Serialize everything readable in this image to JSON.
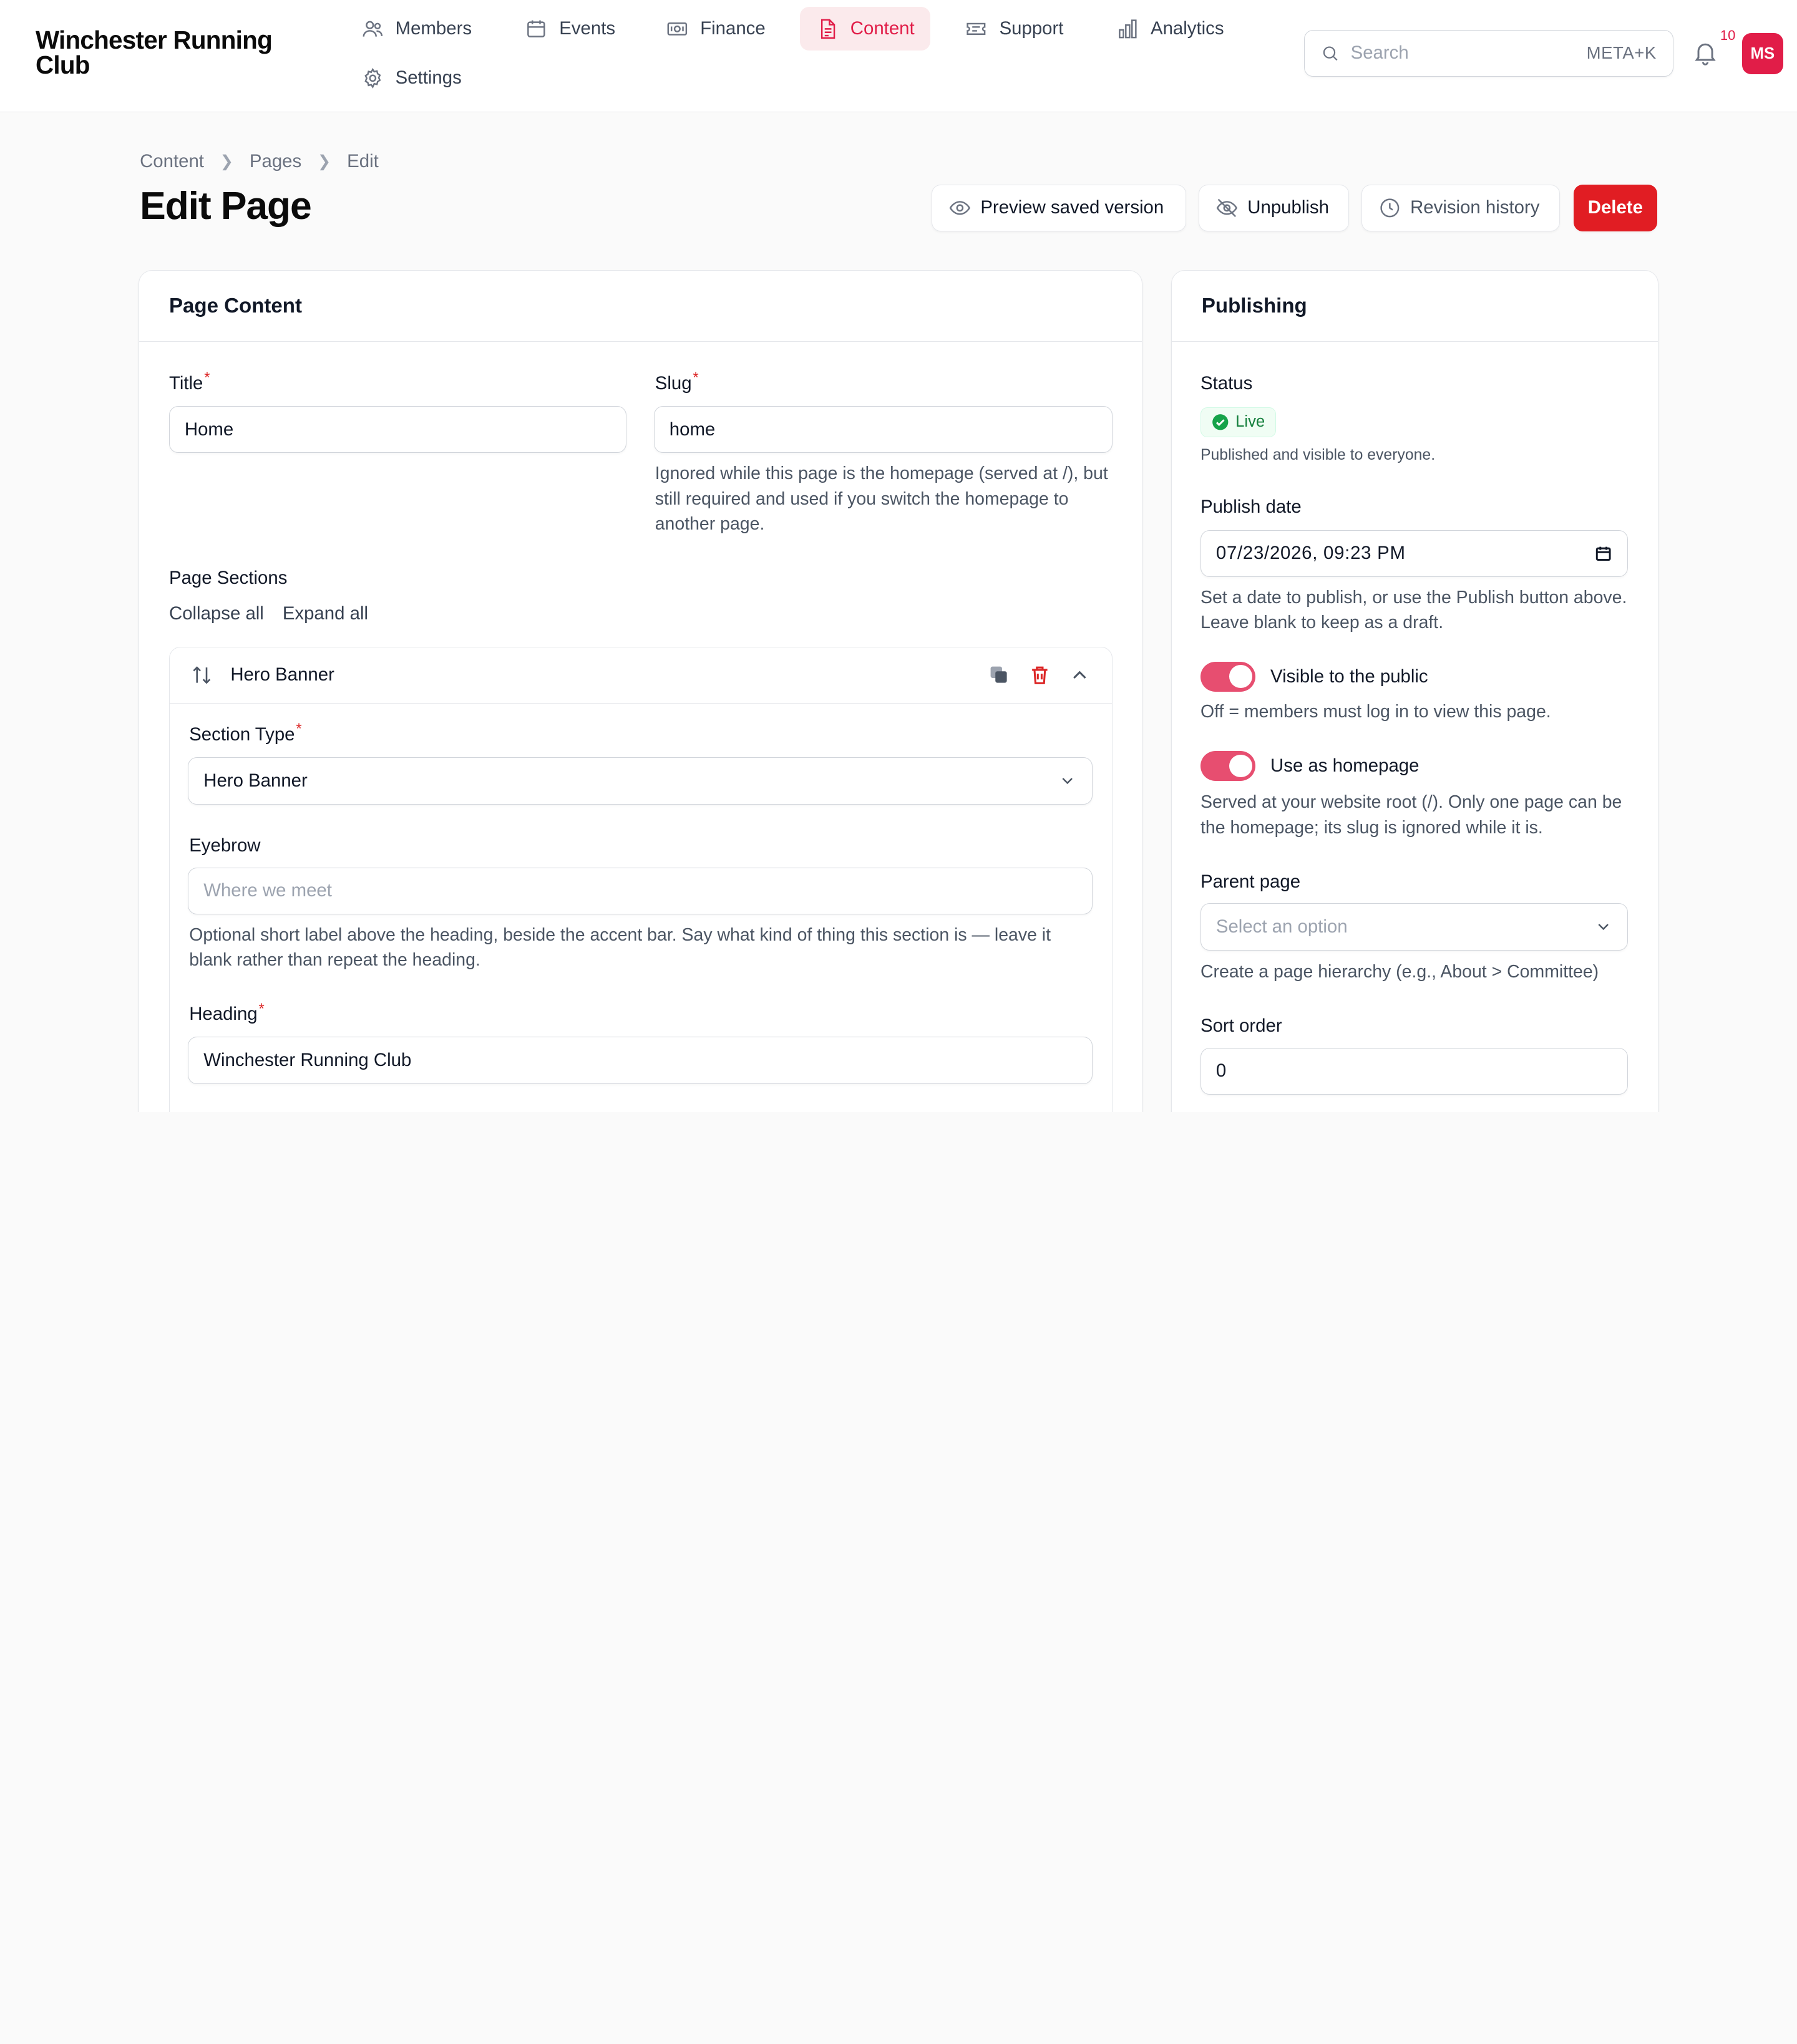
{
  "app": {
    "brand": "Winchester Running Club"
  },
  "nav": {
    "members": "Members",
    "events": "Events",
    "finance": "Finance",
    "content": "Content",
    "support": "Support",
    "analytics": "Analytics",
    "settings": "Settings"
  },
  "search": {
    "placeholder": "Search",
    "shortcut": "META+K"
  },
  "notifications": {
    "count": "10"
  },
  "user": {
    "initials": "MS"
  },
  "accent_color": "#e11d48",
  "breadcrumb": {
    "items": [
      "Content",
      "Pages",
      "Edit"
    ]
  },
  "page": {
    "title": "Edit Page"
  },
  "actions": {
    "preview": "Preview saved version",
    "unpublish": "Unpublish",
    "history": "Revision history",
    "delete": "Delete"
  },
  "content_card": {
    "heading": "Page Content",
    "title_label": "Title",
    "title_value": "Home",
    "slug_label": "Slug",
    "slug_value": "home",
    "slug_help": "Ignored while this page is the homepage (served at /), but still required and used if you switch the homepage to another page.",
    "sections_label": "Page Sections",
    "collapse_all": "Collapse all",
    "expand_all": "Expand all",
    "section": {
      "name": "Hero Banner",
      "type_label": "Section Type",
      "type_value": "Hero Banner",
      "eyebrow_label": "Eyebrow",
      "eyebrow_placeholder": "Where we meet",
      "eyebrow_help": "Optional short label above the heading, beside the accent bar. Say what kind of thing this section is — leave it blank rather than repeat the heading.",
      "heading_label": "Heading",
      "heading_value": "Winchester Running Club"
    }
  },
  "publishing": {
    "heading": "Publishing",
    "status_label": "Status",
    "status_value": "Live",
    "status_help": "Published and visible to everyone.",
    "publish_date_label": "Publish date",
    "publish_date_value": "07/23/2026, 09:23 PM",
    "publish_date_help": "Set a date to publish, or use the Publish button above. Leave blank to keep as a draft.",
    "visible_label": "Visible to the public",
    "visible_on": true,
    "visible_help": "Off = members must log in to view this page.",
    "homepage_label": "Use as homepage",
    "homepage_on": true,
    "homepage_help": "Served at your website root (/). Only one page can be the homepage; its slug is ignored while it is.",
    "parent_label": "Parent page",
    "parent_placeholder": "Select an option",
    "parent_help": "Create a page hierarchy (e.g., About > Committee)",
    "sort_label": "Sort order",
    "sort_value": "0"
  }
}
